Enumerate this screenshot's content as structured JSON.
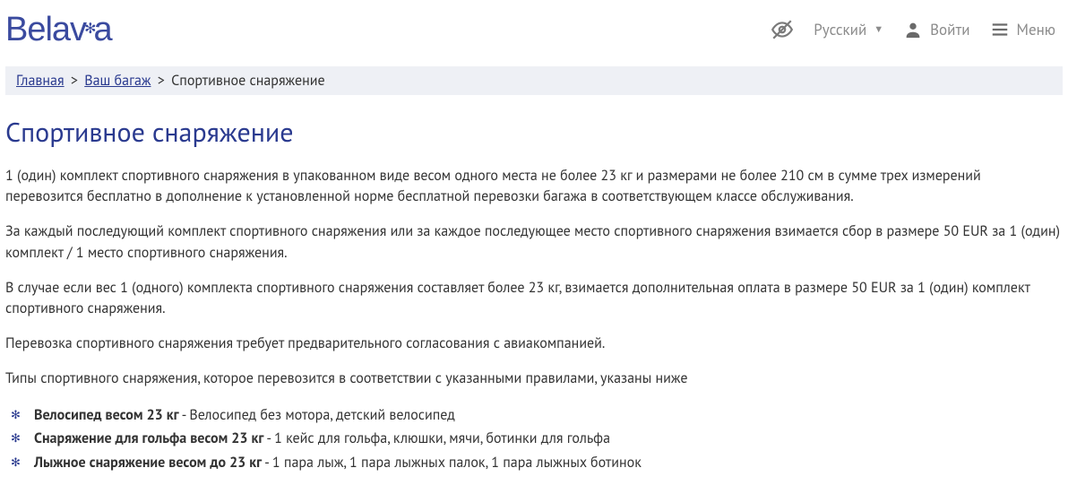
{
  "brand": "Belavia",
  "header": {
    "language_label": "Русский",
    "login_label": "Войти",
    "menu_label": "Меню"
  },
  "breadcrumb": {
    "home": "Главная",
    "baggage": "Ваш багаж",
    "current": "Спортивное снаряжение"
  },
  "page": {
    "title": "Спортивное снаряжение",
    "p1": "1 (один) комплект спортивного снаряжения в упакованном виде весом одного места не более 23 кг и размерами не более 210 см в сумме трех измерений перевозится бесплатно в дополнение к установленной норме бесплатной перевозки багажа в соответствующем классе обслуживания.",
    "p2": "За каждый последующий комплект спортивного снаряжения или за каждое последующее место спортивного снаряжения взимается сбор в размере 50 EUR за 1 (один) комплект / 1 место спортивного снаряжения.",
    "p3": "В случае если вес 1 (одного) комплекта спортивного снаряжения составляет более 23 кг, взимается дополнительная оплата в размере 50 EUR за 1 (один) комплект спортивного снаряжения.",
    "p4": "Перевозка спортивного снаряжения требует предварительного согласования с авиакомпанией.",
    "p5": "Типы спортивного снаряжения, которое перевозится в соответствии с указанными правилами, указаны ниже",
    "items": [
      {
        "bold": "Велосипед весом 23 кг",
        "rest": " - Велосипед без мотора, детский велосипед"
      },
      {
        "bold": "Снаряжение для гольфа весом 23 кг",
        "rest": " - 1 кейс для гольфа, клюшки, мячи, ботинки для гольфа"
      },
      {
        "bold": "Лыжное снаряжение весом до 23 кг",
        "rest": " - 1 пара лыж, 1 пара лыжных палок, 1 пара лыжных ботинок"
      }
    ]
  }
}
